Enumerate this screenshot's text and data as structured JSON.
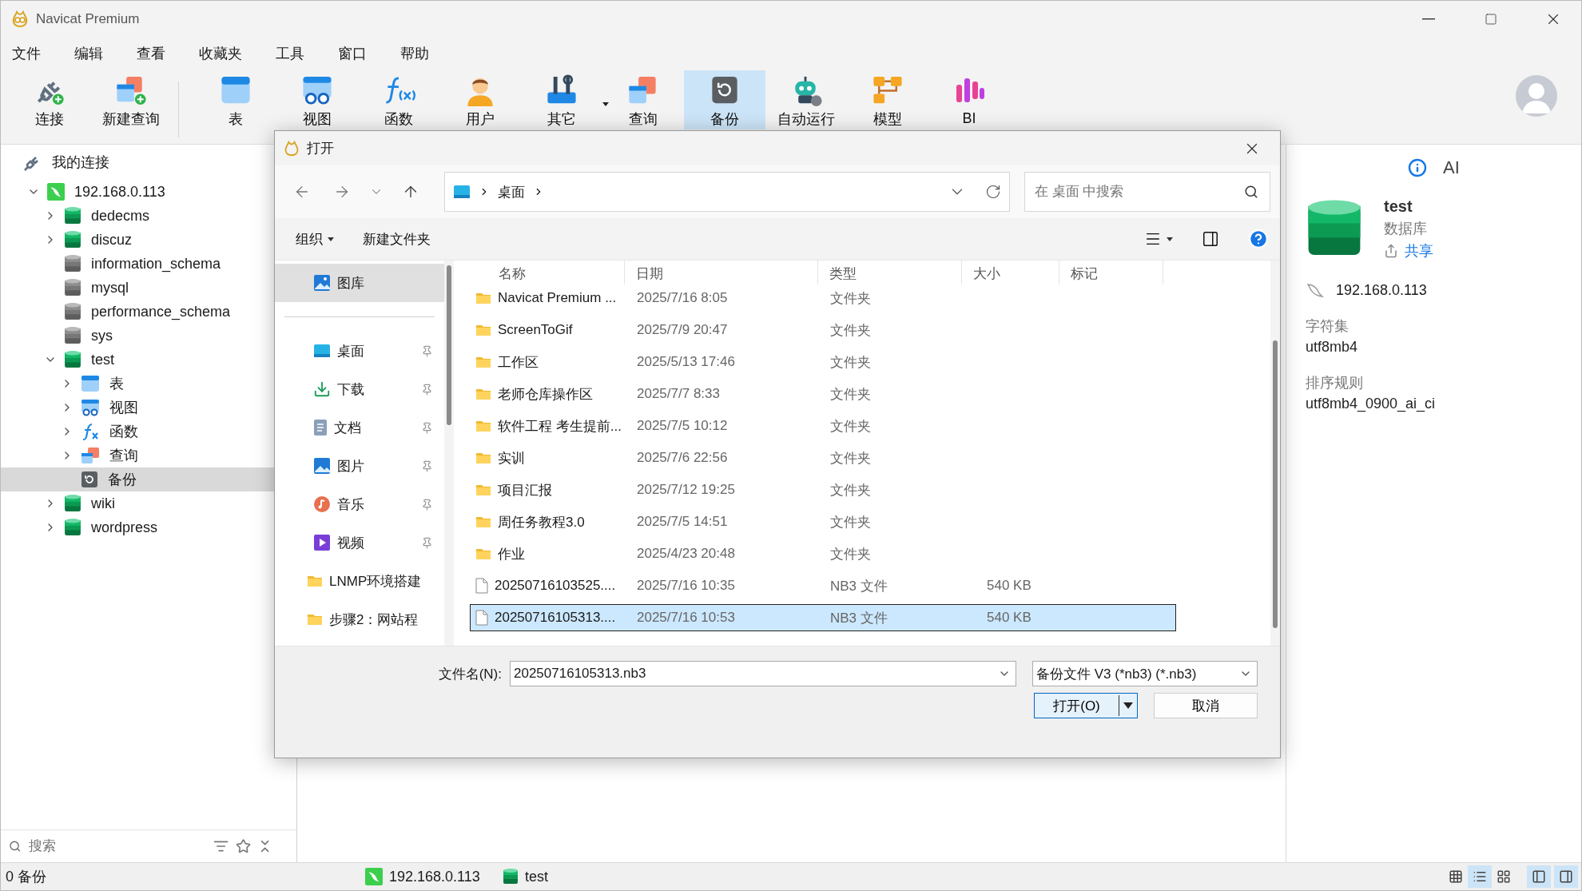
{
  "window": {
    "title": "Navicat Premium"
  },
  "menu": [
    "文件",
    "编辑",
    "查看",
    "收藏夹",
    "工具",
    "窗口",
    "帮助"
  ],
  "toolbar": [
    {
      "label": "连接",
      "kind": "connect",
      "selected": false,
      "has_menu": false
    },
    {
      "label": "新建查询",
      "kind": "newquery",
      "selected": false,
      "has_menu": false
    },
    {
      "label": "表",
      "kind": "table",
      "selected": false,
      "has_menu": false
    },
    {
      "label": "视图",
      "kind": "view",
      "selected": false,
      "has_menu": false
    },
    {
      "label": "函数",
      "kind": "function",
      "selected": false,
      "has_menu": false
    },
    {
      "label": "用户",
      "kind": "user",
      "selected": false,
      "has_menu": false
    },
    {
      "label": "其它",
      "kind": "other",
      "selected": false,
      "has_menu": true
    },
    {
      "label": "查询",
      "kind": "query",
      "selected": false,
      "has_menu": false
    },
    {
      "label": "备份",
      "kind": "backup",
      "selected": true,
      "has_menu": false
    },
    {
      "label": "自动运行",
      "kind": "automation",
      "selected": false,
      "has_menu": false
    },
    {
      "label": "模型",
      "kind": "model",
      "selected": false,
      "has_menu": false
    },
    {
      "label": "BI",
      "kind": "bi",
      "selected": false,
      "has_menu": false
    }
  ],
  "sidebar": {
    "header": "我的连接",
    "search_placeholder": "搜索",
    "tree": [
      {
        "label": "192.168.0.113",
        "kind": "connection",
        "expandable": true,
        "expanded": true,
        "selected": false,
        "children": [
          {
            "label": "dedecms",
            "kind": "database",
            "open": true,
            "expandable": true,
            "expanded": false,
            "selected": false
          },
          {
            "label": "discuz",
            "kind": "database",
            "open": true,
            "expandable": true,
            "expanded": false,
            "selected": false
          },
          {
            "label": "information_schema",
            "kind": "database",
            "open": false,
            "expandable": false,
            "selected": false
          },
          {
            "label": "mysql",
            "kind": "database",
            "open": false,
            "expandable": false,
            "selected": false
          },
          {
            "label": "performance_schema",
            "kind": "database",
            "open": false,
            "expandable": false,
            "selected": false
          },
          {
            "label": "sys",
            "kind": "database",
            "open": false,
            "expandable": false,
            "selected": false
          },
          {
            "label": "test",
            "kind": "database",
            "open": true,
            "expandable": true,
            "expanded": true,
            "selected": false,
            "children": [
              {
                "label": "表",
                "kind": "table",
                "expandable": true,
                "expanded": false,
                "selected": false
              },
              {
                "label": "视图",
                "kind": "view",
                "expandable": true,
                "expanded": false,
                "selected": false
              },
              {
                "label": "函数",
                "kind": "function",
                "expandable": true,
                "expanded": false,
                "selected": false
              },
              {
                "label": "查询",
                "kind": "query",
                "expandable": true,
                "expanded": false,
                "selected": false
              },
              {
                "label": "备份",
                "kind": "backup",
                "expandable": false,
                "selected": true
              }
            ]
          },
          {
            "label": "wiki",
            "kind": "database",
            "open": true,
            "expandable": true,
            "expanded": false,
            "selected": false
          },
          {
            "label": "wordpress",
            "kind": "database",
            "open": true,
            "expandable": true,
            "expanded": false,
            "selected": false
          }
        ]
      }
    ]
  },
  "right_panel": {
    "tabs": [
      {
        "kind": "info",
        "selected": true
      },
      {
        "kind": "ai",
        "label": "AI",
        "selected": false
      }
    ],
    "name": "test",
    "type": "数据库",
    "share": "共享",
    "host": "192.168.0.113",
    "fields": [
      {
        "label": "字符集",
        "value": "utf8mb4"
      },
      {
        "label": "排序规则",
        "value": "utf8mb4_0900_ai_ci"
      }
    ]
  },
  "dialog": {
    "title": "打开",
    "path": [
      "桌面"
    ],
    "search_placeholder": "在 桌面 中搜索",
    "commands": [
      "组织",
      "新建文件夹"
    ],
    "nav_pane": [
      {
        "label": "图库",
        "kind": "gallery",
        "pinned": false,
        "selected": true
      },
      {
        "label": "桌面",
        "kind": "desktop",
        "pinned": true,
        "selected": false
      },
      {
        "label": "下载",
        "kind": "downloads",
        "pinned": true,
        "selected": false
      },
      {
        "label": "文档",
        "kind": "documents",
        "pinned": true,
        "selected": false
      },
      {
        "label": "图片",
        "kind": "pictures",
        "pinned": true,
        "selected": false
      },
      {
        "label": "音乐",
        "kind": "music",
        "pinned": true,
        "selected": false
      },
      {
        "label": "视频",
        "kind": "videos",
        "pinned": true,
        "selected": false
      },
      {
        "label": "LNMP环境搭建",
        "kind": "folder",
        "pinned": false,
        "selected": false
      },
      {
        "label": "步骤2：网站程",
        "kind": "folder",
        "pinned": false,
        "selected": false
      }
    ],
    "columns": [
      "名称",
      "日期",
      "类型",
      "大小",
      "标记"
    ],
    "rows": [
      {
        "name": "Navicat Premium ...",
        "date": "2025/7/16 8:05",
        "type": "文件夹",
        "kind": "folder",
        "selected": false
      },
      {
        "name": "ScreenToGif",
        "date": "2025/7/9 20:47",
        "type": "文件夹",
        "kind": "folder",
        "selected": false
      },
      {
        "name": "工作区",
        "date": "2025/5/13 17:46",
        "type": "文件夹",
        "kind": "folder",
        "selected": false
      },
      {
        "name": "老师仓库操作区",
        "date": "2025/7/7 8:33",
        "type": "文件夹",
        "kind": "folder",
        "selected": false
      },
      {
        "name": "软件工程 考生提前...",
        "date": "2025/7/5 10:12",
        "type": "文件夹",
        "kind": "folder",
        "selected": false
      },
      {
        "name": "实训",
        "date": "2025/7/6 22:56",
        "type": "文件夹",
        "kind": "folder",
        "selected": false
      },
      {
        "name": "项目汇报",
        "date": "2025/7/12 19:25",
        "type": "文件夹",
        "kind": "folder",
        "selected": false
      },
      {
        "name": "周任务教程3.0",
        "date": "2025/7/5 14:51",
        "type": "文件夹",
        "kind": "folder",
        "selected": false
      },
      {
        "name": "作业",
        "date": "2025/4/23 20:48",
        "type": "文件夹",
        "kind": "folder",
        "selected": false
      },
      {
        "name": "20250716103525....",
        "date": "2025/7/16 10:35",
        "type": "NB3 文件",
        "size": "540 KB",
        "kind": "file",
        "selected": false
      },
      {
        "name": "20250716105313....",
        "date": "2025/7/16 10:53",
        "type": "NB3 文件",
        "size": "540 KB",
        "kind": "file",
        "selected": true
      }
    ],
    "file_name_label": "文件名(N):",
    "file_name": "20250716105313.nb3",
    "filter": "备份文件 V3 (*nb3) (*.nb3)",
    "open_button": "打开(O)",
    "cancel_button": "取消"
  },
  "status_bar": {
    "count": "0 备份",
    "connection": "192.168.0.113",
    "database": "test",
    "views": [
      {
        "kind": "grid",
        "selected": false
      },
      {
        "kind": "list",
        "selected": true
      },
      {
        "kind": "detail",
        "selected": false
      }
    ],
    "panels": [
      {
        "kind": "left",
        "selected": true
      },
      {
        "kind": "right",
        "selected": true
      }
    ]
  }
}
